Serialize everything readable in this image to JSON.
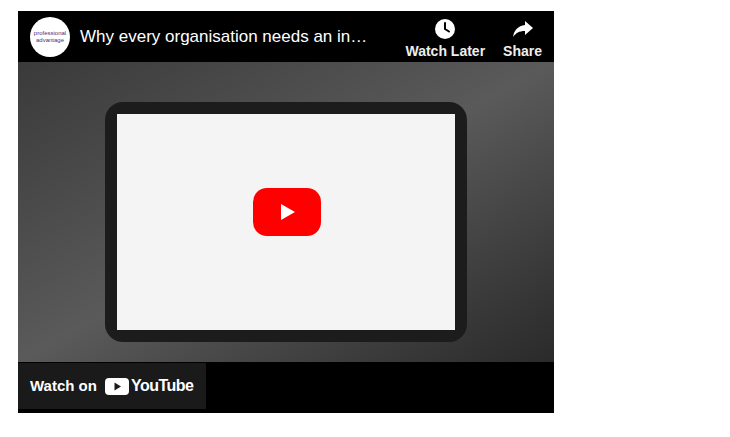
{
  "video": {
    "title": "Why every organisation needs an in…",
    "channel_logo": "professional advantage"
  },
  "actions": [
    {
      "label": "Watch Later"
    },
    {
      "label": "Share"
    }
  ],
  "watch_on": {
    "label": "Watch on",
    "brand": "YouTube"
  }
}
